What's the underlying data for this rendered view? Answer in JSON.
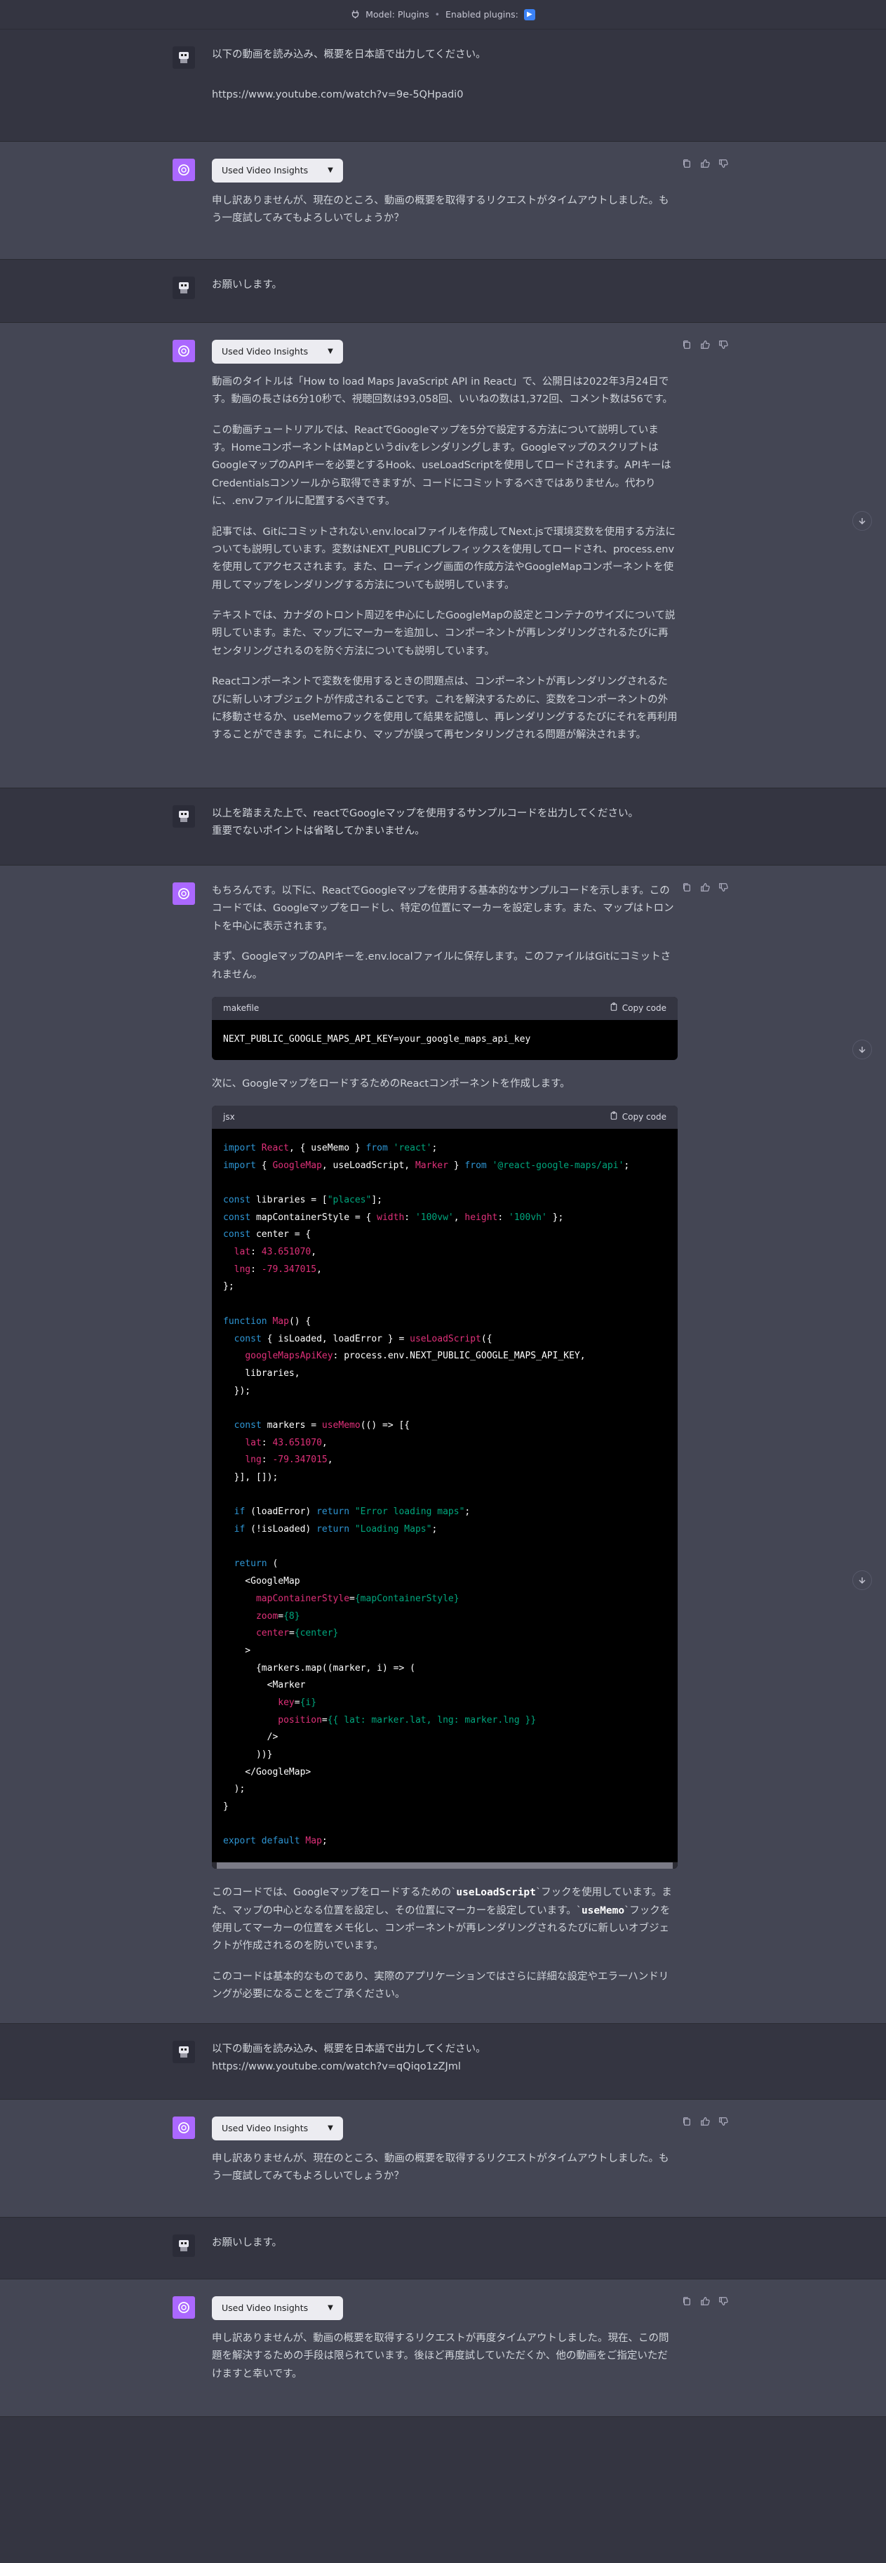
{
  "header": {
    "model": "Model: Plugins",
    "separator": "•",
    "enabled_plugins_label": "Enabled plugins:"
  },
  "colors": {
    "background": "#343541",
    "assistant_bg": "#444654",
    "bot_avatar": "#ab68ff",
    "code_bg": "#000000"
  },
  "plugin_pill_label": "Used Video Insights",
  "messages": [
    {
      "role": "user",
      "p1": "以下の動画を読み込み、概要を日本語で出力してください。",
      "p2": "https://www.youtube.com/watch?v=9e-5QHpadi0"
    },
    {
      "role": "assistant",
      "p1": "申し訳ありませんが、現在のところ、動画の概要を取得するリクエストがタイムアウトしました。もう一度試してみてもよろしいでしょうか？"
    },
    {
      "role": "user",
      "p1": "お願いします。"
    },
    {
      "role": "assistant",
      "paras": [
        "動画のタイトルは「How to load Maps JavaScript API in React」で、公開日は2022年3月24日です。動画の長さは6分10秒で、視聴回数は93,058回、いいねの数は1,372回、コメント数は56です。",
        "この動画チュートリアルでは、ReactでGoogleマップを5分で設定する方法について説明しています。HomeコンポーネントはMapというdivをレンダリングします。GoogleマップのスクリプトはGoogleマップのAPIキーを必要とするHook、useLoadScriptを使用してロードされます。APIキーはCredentialsコンソールから取得できますが、コードにコミットするべきではありません。代わりに、.envファイルに配置するべきです。",
        "記事では、Gitにコミットされない.env.localファイルを作成してNext.jsで環境変数を使用する方法についても説明しています。変数はNEXT_PUBLICプレフィックスを使用してロードされ、process.envを使用してアクセスされます。また、ローディング画面の作成方法やGoogleMapコンポーネントを使用してマップをレンダリングする方法についても説明しています。",
        "テキストでは、カナダのトロント周辺を中心にしたGoogleMapの設定とコンテナのサイズについて説明しています。また、マップにマーカーを追加し、コンポーネントが再レンダリングされるたびに再センタリングされるのを防ぐ方法についても説明しています。",
        "Reactコンポーネントで変数を使用するときの問題点は、コンポーネントが再レンダリングされるたびに新しいオブジェクトが作成されることです。これを解決するために、変数をコンポーネントの外に移動させるか、useMemoフックを使用して結果を記憶し、再レンダリングするたびにそれを再利用することができます。これにより、マップが誤って再センタリングされる問題が解決されます。"
      ]
    },
    {
      "role": "user",
      "p1": "以上を踏まえた上で、reactでGoogleマップを使用するサンプルコードを出力してください。",
      "p2": "重要でないポイントは省略してかまいません。"
    },
    {
      "role": "assistant",
      "intro": "もちろんです。以下に、ReactでGoogleマップを使用する基本的なサンプルコードを示します。このコードでは、Googleマップをロードし、特定の位置にマーカーを設定します。また、マップはトロントを中心に表示されます。",
      "env_note": "まず、GoogleマップのAPIキーを.env.localファイルに保存します。このファイルはGitにコミットされません。",
      "code1_lang": "makefile",
      "copy_label": "Copy code",
      "code1": "NEXT_PUBLIC_GOOGLE_MAPS_API_KEY=your_google_maps_api_key",
      "component_note": "次に、GoogleマップをロードするためのReactコンポーネントを作成します。",
      "code2_lang": "jsx",
      "explain_pre": "このコードでは、Googleマップをロードするための`",
      "explain_code1": "useLoadScript",
      "explain_mid": "`フックを使用しています。また、マップの中心となる位置を設定し、その位置にマーカーを設定しています。`",
      "explain_code2": "useMemo",
      "explain_post": "`フックを使用してマーカーの位置をメモ化し、コンポーネントが再レンダリングされるたびに新しいオブジェクトが作成されるのを防いでいます。",
      "closing": "このコードは基本的なものであり、実際のアプリケーションではさらに詳細な設定やエラーハンドリングが必要になることをご了承ください。"
    },
    {
      "role": "user",
      "p1": "以下の動画を読み込み、概要を日本語で出力してください。",
      "p2": "https://www.youtube.com/watch?v=qQiqo1zZJml"
    },
    {
      "role": "assistant",
      "p1": "申し訳ありませんが、現在のところ、動画の概要を取得するリクエストがタイムアウトしました。もう一度試してみてもよろしいでしょうか？"
    },
    {
      "role": "user",
      "p1": "お願いします。"
    },
    {
      "role": "assistant",
      "p1": "申し訳ありませんが、動画の概要を取得するリクエストが再度タイムアウトしました。現在、この問題を解決するための手段は限られています。後ほど再度試していただくか、他の動画をご指定いただけますと幸いです。"
    }
  ]
}
